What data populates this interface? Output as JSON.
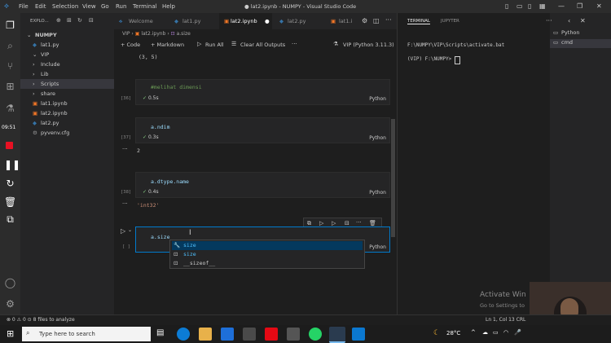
{
  "titlebar": {
    "menu": [
      "File",
      "Edit",
      "Selection",
      "View",
      "Go",
      "Run",
      "Terminal",
      "Help"
    ],
    "title": "● lat2.ipynb - NUMPY - Visual Studio Code"
  },
  "explorer": {
    "header": "EXPLO...",
    "root": "NUMPY",
    "items": [
      {
        "label": "lat1.py",
        "indent": 1
      },
      {
        "label": "VIP",
        "indent": 1
      },
      {
        "label": "Include",
        "indent": 2
      },
      {
        "label": "Lib",
        "indent": 2
      },
      {
        "label": "Scripts",
        "indent": 2
      },
      {
        "label": "share",
        "indent": 2
      },
      {
        "label": "lat1.ipynb",
        "indent": 1
      },
      {
        "label": "lat2.ipynb",
        "indent": 1
      },
      {
        "label": "lat2.py",
        "indent": 1
      },
      {
        "label": "pyvenv.cfg",
        "indent": 1
      }
    ]
  },
  "activity": {
    "time": "09:51"
  },
  "tabs": [
    "Welcome",
    "lat1.py",
    "lat2.ipynb",
    "lat2.py",
    "lat1.i"
  ],
  "breadcrumb": {
    "a": "VIP",
    "b": "lat2.ipynb",
    "c": "a.size"
  },
  "toolbar": {
    "code": "+ Code",
    "markdown": "+ Markdown",
    "run_all": "Run All",
    "clear": "Clear All Outputs",
    "more": "···",
    "kernel": "VIP (Python 3.11.3)"
  },
  "editor": {
    "top_output": "(3, 5)",
    "cells": [
      {
        "code": "#melihat dimensi",
        "exec": "[36]",
        "time": "0.5s",
        "lang": "Python",
        "output": ""
      },
      {
        "code": "a.ndim",
        "exec": "[37]",
        "time": "0.3s",
        "lang": "Python",
        "output": "2"
      },
      {
        "code": "a.dtype.name",
        "exec": "[38]",
        "time": "0.4s",
        "lang": "Python",
        "output": "'int32'"
      }
    ],
    "active_cell": {
      "code": "a.size",
      "exec": "[ ]",
      "lang": "Python"
    }
  },
  "suggest": {
    "items": [
      "size",
      "size",
      "__sizeof__"
    ]
  },
  "panel": {
    "tabs": [
      "TERMINAL",
      "JUPYTER"
    ],
    "lines": [
      "F:\\NUMPY\\VIP\\Scripts\\activate.bat",
      "(VIP) F:\\NUMPY>"
    ],
    "terminals": [
      "Python",
      "cmd"
    ]
  },
  "statusbar": {
    "left": "⊗ 0 ⚠ 0   ⊙ 8 files to analyze",
    "right": "Ln 1, Col 13   CRL"
  },
  "watermark": {
    "line1": "Activate Win",
    "line2": "Go to Settings to"
  },
  "taskbar": {
    "search": "Type here to search",
    "temp": "28°C"
  },
  "colors": {
    "accent": "#007acc",
    "string": "#ce9178",
    "comment": "#6a9955",
    "code": "#9cdcfe"
  }
}
